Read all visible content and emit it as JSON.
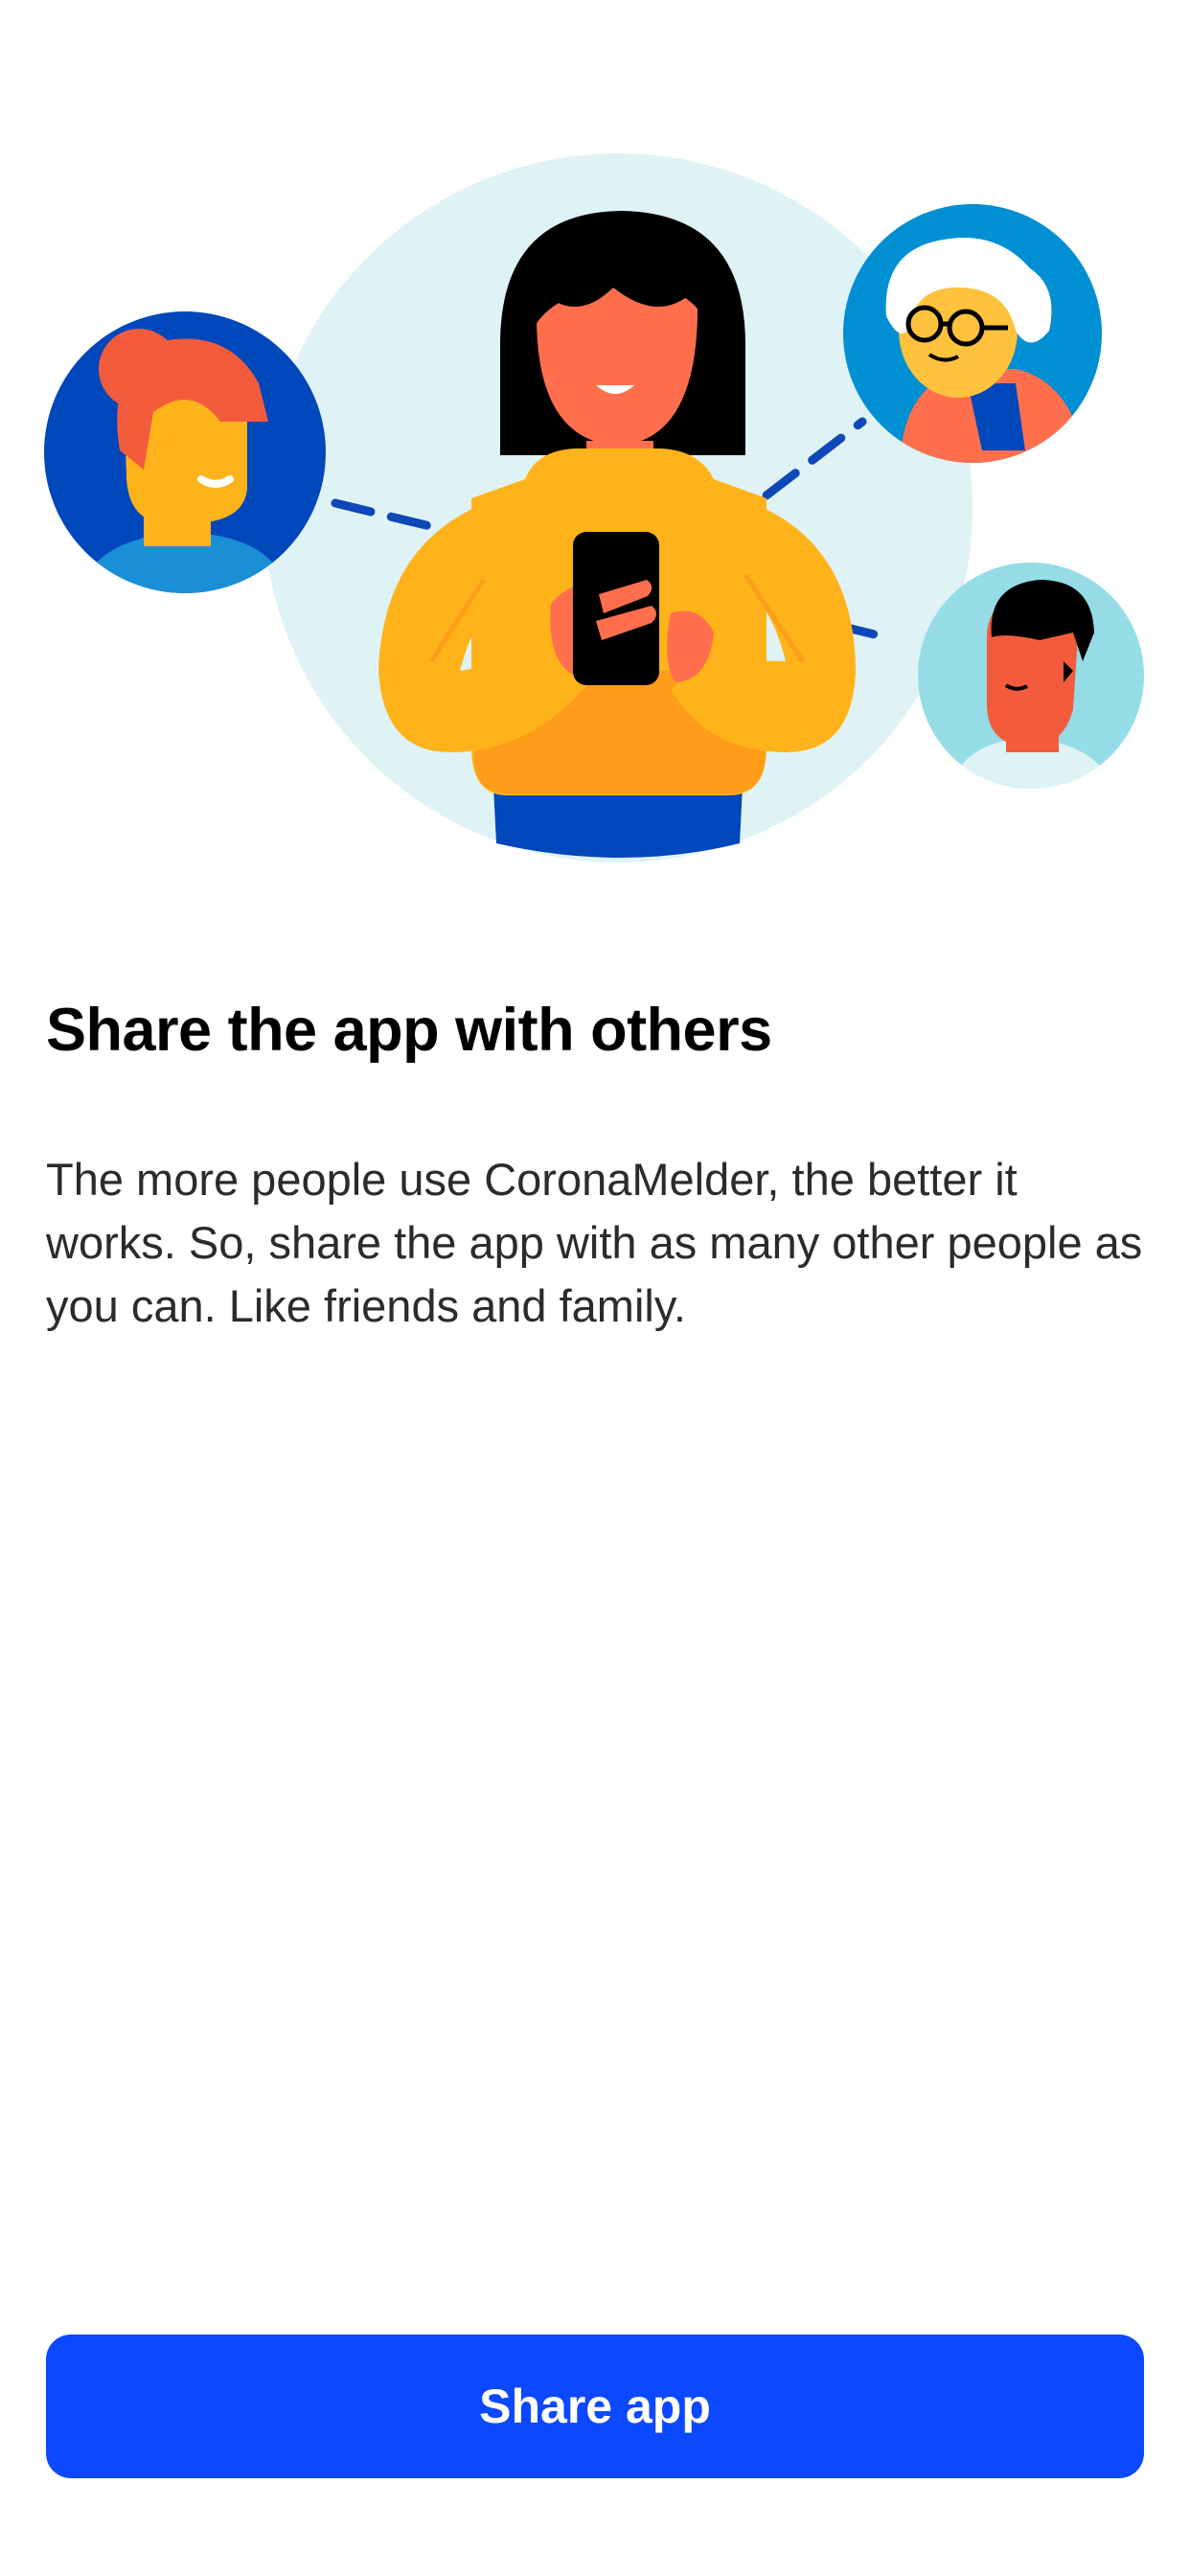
{
  "illustration": {
    "icon": "people-sharing-app-illustration",
    "colors": {
      "backdrop": "#dff3f6",
      "dashed_line": "#0d47b8",
      "main_sweater": "#ffb31a",
      "main_skin": "#ff6f4e",
      "phone": "#000000",
      "avatar_left_bg": "#0047bb",
      "avatar_top_right_bg": "#008fd2",
      "avatar_right_bg": "#95dce6"
    }
  },
  "content": {
    "title": "Share the app with others",
    "body": "The more people use CoronaMelder, the better it works. So, share the app with as many other people as you can. Like friends and family."
  },
  "actions": {
    "share_label": "Share app",
    "share_color": "#0c48ff"
  }
}
